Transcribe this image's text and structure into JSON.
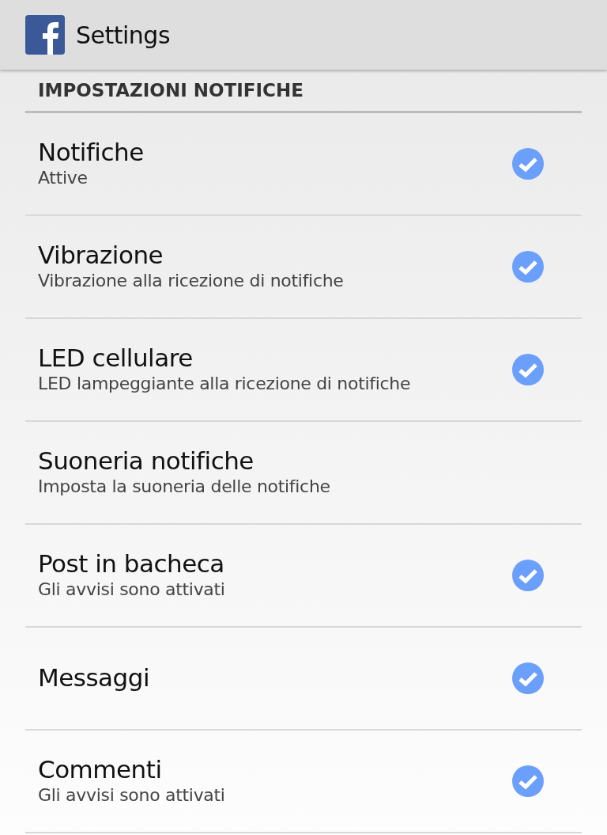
{
  "app_bar": {
    "title": "Settings"
  },
  "section": {
    "title": "IMPOSTAZIONI NOTIFICHE"
  },
  "items": [
    {
      "kind": "check",
      "title": "Notifiche",
      "summary": "Attive",
      "checked": true
    },
    {
      "kind": "check",
      "title": "Vibrazione",
      "summary": "Vibrazione alla ricezione di notifiche",
      "checked": true
    },
    {
      "kind": "check",
      "title": "LED cellulare",
      "summary": "LED lampeggiante alla ricezione di notifiche",
      "checked": true
    },
    {
      "kind": "plain",
      "title": "Suoneria notifiche",
      "summary": "Imposta la suoneria delle notifiche"
    },
    {
      "kind": "check",
      "title": "Post in bacheca",
      "summary": "Gli avvisi sono attivati",
      "checked": true
    },
    {
      "kind": "check",
      "title": "Messaggi",
      "checked": true
    },
    {
      "kind": "check",
      "title": "Commenti",
      "summary": "Gli avvisi sono attivati",
      "checked": true
    }
  ]
}
